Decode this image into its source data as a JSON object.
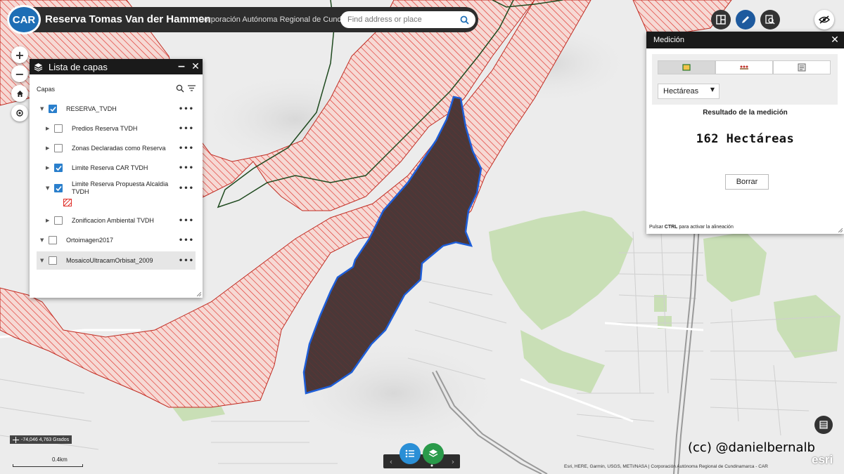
{
  "header": {
    "logo_text": "CAR",
    "title": "Reserva Tomas Van der Hammen",
    "subtitle": "Corporación Autónoma Regional de Cundinamarca",
    "search_placeholder": "Find address or place"
  },
  "header_tools": {
    "icons": [
      "layout-icon",
      "draw-icon",
      "query-icon",
      "visibility-icon"
    ]
  },
  "layer_list": {
    "title": "Lista de capas",
    "section_label": "Capas",
    "layers": [
      {
        "label": "RESERVA_TVDH",
        "checked": true,
        "expanded": true
      },
      {
        "label": "Predios Reserva TVDH",
        "checked": false,
        "expanded": false
      },
      {
        "label": "Zonas Declaradas como Reserva",
        "checked": false,
        "expanded": false
      },
      {
        "label": "Limite Reserva CAR TVDH",
        "checked": true,
        "expanded": false
      },
      {
        "label": "Limite Reserva Propuesta Alcaldia",
        "label2": "TVDH",
        "checked": true,
        "expanded": true
      },
      {
        "label": "Zonificacion Ambiental TVDH",
        "checked": false,
        "expanded": false
      },
      {
        "label": "Ortoimagen2017",
        "checked": false,
        "expanded": true
      },
      {
        "label": "MosaicoUltracamOrbisat_2009",
        "checked": false,
        "expanded": true
      }
    ]
  },
  "measure": {
    "title": "Medición",
    "unit": "Hectáreas",
    "result_label": "Resultado de la medición",
    "result_value": "162 Hectáreas",
    "clear_label": "Borrar",
    "hint_prefix": "Pulsar ",
    "hint_key": "CTRL",
    "hint_suffix": " para activar la alineación"
  },
  "map": {
    "coordinates": "-74,046 4,763 Grados",
    "scale_label": "0.4km",
    "attribution": "Esri, HERE, Garmin, USGS, METI/NASA | Corporación Autónoma Regional de Cundinamarca - CAR",
    "watermark": "(cc) @danielbernalb",
    "esri_logo": "esri",
    "colors": {
      "reserve_hatch": "#e0302a",
      "reserve_fill": "#f6d9d4",
      "measured_fill": "#4a3838",
      "measured_outline": "#1e5ed8",
      "boundary_line": "#1f4a1f",
      "green_area": "#c9dfb6",
      "base": "#ececec"
    }
  }
}
